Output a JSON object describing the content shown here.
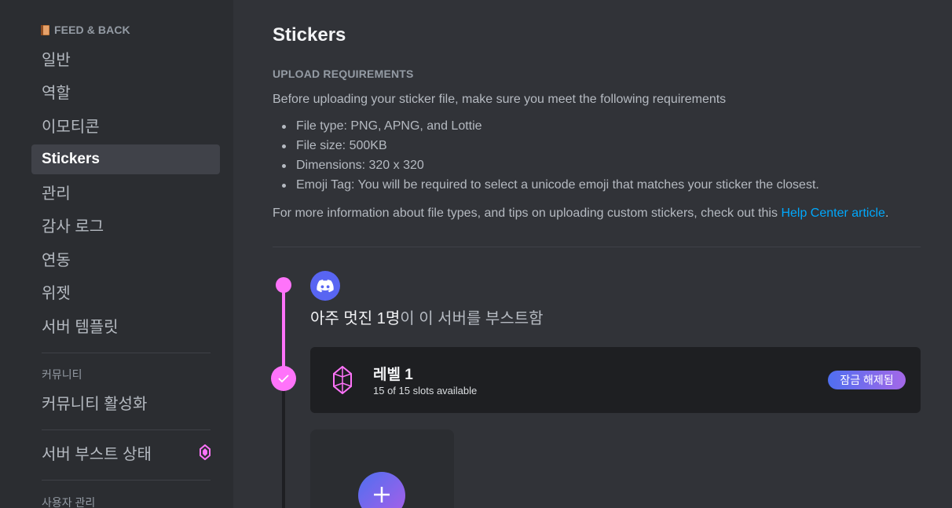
{
  "sidebar": {
    "server_name": "FEED & BACK",
    "items": [
      {
        "label": "일반"
      },
      {
        "label": "역할"
      },
      {
        "label": "이모티콘"
      },
      {
        "label": "Stickers",
        "active": true
      },
      {
        "label": "관리"
      },
      {
        "label": "감사 로그"
      },
      {
        "label": "연동"
      },
      {
        "label": "위젯"
      },
      {
        "label": "서버 템플릿"
      }
    ],
    "community_category": "커뮤니티",
    "community_item": "커뮤니티 활성화",
    "boost_item": "서버 부스트 상태",
    "user_category": "사용자 관리"
  },
  "main": {
    "title": "Stickers",
    "requirements_heading": "UPLOAD REQUIREMENTS",
    "requirements_intro": "Before uploading your sticker file, make sure you meet the following requirements",
    "requirements": [
      "File type: PNG, APNG, and Lottie",
      "File size: 500KB",
      "Dimensions: 320 x 320",
      "Emoji Tag: You will be required to select a unicode emoji that matches your sticker the closest."
    ],
    "more_info_text": "For more information about file types, and tips on uploading custom stickers, check out this ",
    "help_link": "Help Center article",
    "more_info_end": ".",
    "boost_count_text": "아주 멋진 1명",
    "boost_rest_text": "이 이 서버를 부스트함",
    "level": {
      "name": "레벨 1",
      "slots": "15 of 15 slots available",
      "status": "잠금 해제됨"
    }
  },
  "colors": {
    "accent_pink": "#ff73fa",
    "blurple": "#5865f2",
    "link": "#00a8fc"
  }
}
